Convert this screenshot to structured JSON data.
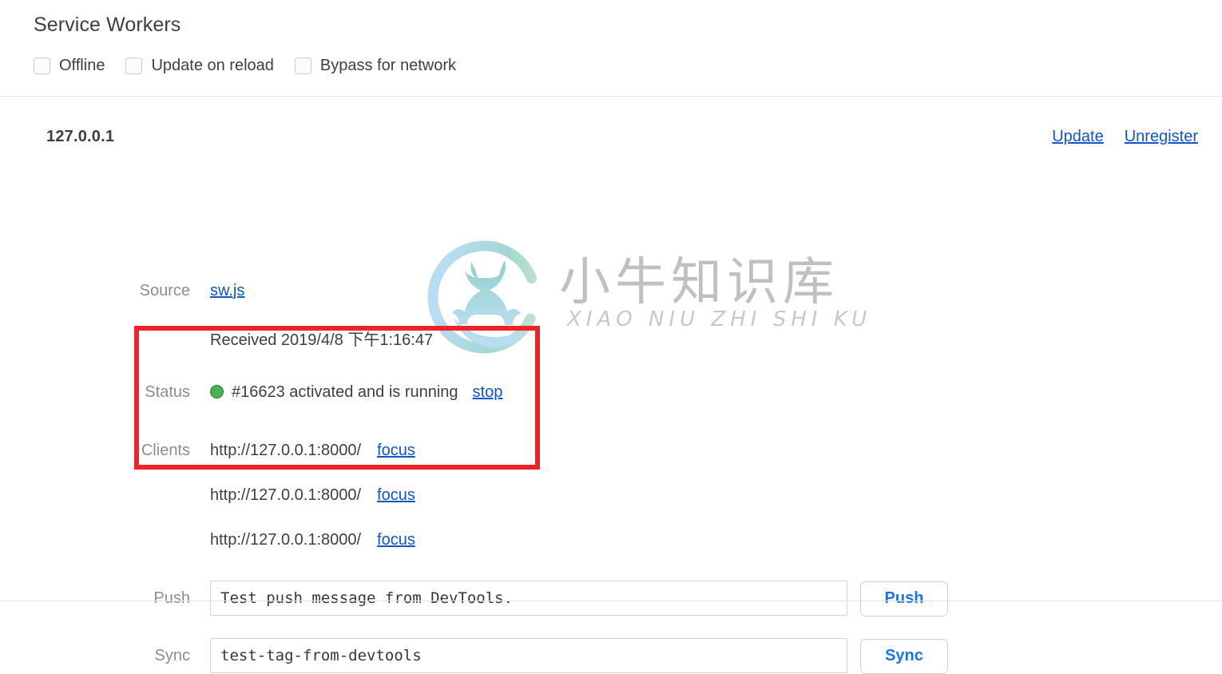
{
  "panel": {
    "title": "Service Workers",
    "options": [
      {
        "label": "Offline",
        "checked": false,
        "name": "offline"
      },
      {
        "label": "Update on reload",
        "checked": false,
        "name": "update-on-reload"
      },
      {
        "label": "Bypass for network",
        "checked": false,
        "name": "bypass-for-network"
      }
    ]
  },
  "registration": {
    "origin": "127.0.0.1",
    "actions": {
      "update": "Update",
      "unregister": "Unregister"
    },
    "rows": {
      "source": {
        "label": "Source",
        "link": "sw.js",
        "received": "Received 2019/4/8 下午1:16:47"
      },
      "status": {
        "label": "Status",
        "text": "#16623 activated and is running",
        "stop_link": "stop",
        "dot_color": "#4caf50"
      },
      "clients": {
        "label": "Clients",
        "items": [
          {
            "url": "http://127.0.0.1:8000/",
            "focus_link": "focus"
          },
          {
            "url": "http://127.0.0.1:8000/",
            "focus_link": "focus"
          },
          {
            "url": "http://127.0.0.1:8000/",
            "focus_link": "focus"
          }
        ]
      },
      "push": {
        "label": "Push",
        "value": "Test push message from DevTools.",
        "placeholder": "Test push message from DevTools.",
        "button": "Push"
      },
      "sync": {
        "label": "Sync",
        "value": "test-tag-from-devtools",
        "placeholder": "test-tag-from-devtools",
        "button": "Sync"
      }
    }
  },
  "annotation": {
    "color": "#ee2229",
    "target": "clients"
  },
  "watermark": {
    "chinese": "小牛知识库",
    "pinyin": "XIAO NIU ZHI SHI KU",
    "logo_name": "bull-ring-logo"
  },
  "colors": {
    "link": "#1155cc",
    "button_text": "#1a73e8",
    "label": "#8d8d8d",
    "text": "#3b4045",
    "divider": "#e3e3e3",
    "annotation": "#ee2229",
    "status_green": "#4caf50"
  }
}
